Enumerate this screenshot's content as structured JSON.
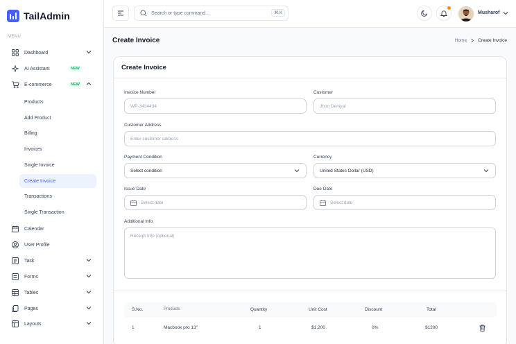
{
  "brand": {
    "name": "TailAdmin"
  },
  "sidebar": {
    "menu_label": "MENU",
    "items": [
      {
        "label": "Dashboard",
        "icon": "grid-icon"
      },
      {
        "label": "AI Assistant",
        "icon": "sparkle-icon",
        "badge": "NEW"
      },
      {
        "label": "E-commerce",
        "icon": "cart-icon",
        "badge": "NEW"
      },
      {
        "label": "Calendar",
        "icon": "calendar-icon"
      },
      {
        "label": "User Profile",
        "icon": "user-circle-icon"
      },
      {
        "label": "Task",
        "icon": "task-icon"
      },
      {
        "label": "Forms",
        "icon": "forms-icon"
      },
      {
        "label": "Tables",
        "icon": "table-icon"
      },
      {
        "label": "Pages",
        "icon": "pages-icon"
      },
      {
        "label": "Layouts",
        "icon": "layout-icon"
      }
    ],
    "ecommerce_sub": [
      "Products",
      "Add Product",
      "Billing",
      "Invoices",
      "Single Invoice",
      "Create Invoice",
      "Transactions",
      "Single Transaction"
    ],
    "active_sub": "Create Invoice"
  },
  "header": {
    "search_placeholder": "Search or type command...",
    "search_shortcut": "⌘ K",
    "user_name": "Musharof"
  },
  "page": {
    "title": "Create Invoice",
    "breadcrumb": {
      "home": "Home",
      "current": "Create Invoice"
    }
  },
  "form": {
    "title": "Create Invoice",
    "invoice_number": {
      "label": "Invoice Number",
      "placeholder": "WP-3434434"
    },
    "customer": {
      "label": "Customer",
      "placeholder": "Jhon Deniyal"
    },
    "customer_address": {
      "label": "Customer Address",
      "placeholder": "Enter customer address"
    },
    "payment_condition": {
      "label": "Payment Condition",
      "value": "Select condition"
    },
    "currency": {
      "label": "Currency",
      "value": "United States Dollar (USD)"
    },
    "issue_date": {
      "label": "Issue Date",
      "placeholder": "Select date"
    },
    "due_date": {
      "label": "Due Date",
      "placeholder": "Select date"
    },
    "additional_info": {
      "label": "Additional Info",
      "placeholder": "Receipt Info (optional)"
    }
  },
  "table": {
    "headers": [
      "S.No.",
      "Products",
      "Quantity",
      "Unit Cost",
      "Discount",
      "Total"
    ],
    "rows": [
      [
        "1",
        "Macbook pro 13\"",
        "1",
        "$1,200",
        "0%",
        "$1200"
      ]
    ]
  },
  "colors": {
    "accent": "#465fff",
    "badge_green": "#12b76a",
    "notification": "#f79009"
  }
}
